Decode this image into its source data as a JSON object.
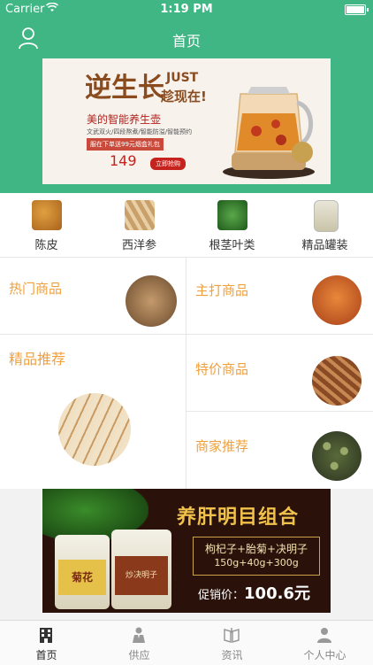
{
  "status_bar": {
    "carrier": "Carrier",
    "time": "1:19 PM"
  },
  "nav": {
    "title": "首页"
  },
  "banner": {
    "headline": "逆生长",
    "headline_en": "JUST",
    "tagline": "趁现在!",
    "subtitle": "美的智能养生壶",
    "features": "文武双火/四段熬煮/智能防溢/智能预约",
    "gift": "服在下单送99元烟盒礼包",
    "price": "149",
    "buy_label": "立即抢购"
  },
  "categories": [
    {
      "label": "陈皮",
      "color": "#c9862e"
    },
    {
      "label": "西洋参",
      "color": "#b98a4e"
    },
    {
      "label": "根茎叶类",
      "color": "#3f8a3a"
    },
    {
      "label": "精品罐装",
      "color": "#d8d8cc"
    }
  ],
  "sections": {
    "hot": "热门商品",
    "main": "主打商品",
    "featured": "精品推荐",
    "special": "特价商品",
    "merchant": "商家推荐"
  },
  "ad": {
    "headline": "养肝明目组合",
    "combo": "枸杞子+胎菊+决明子",
    "weights": "150g+40g+300g",
    "price_label": "促销价：",
    "price_value": "100.6元",
    "jar1": "菊花",
    "jar2": "炒决明子"
  },
  "tabs": [
    {
      "label": "首页",
      "active": true
    },
    {
      "label": "供应",
      "active": false
    },
    {
      "label": "资讯",
      "active": false
    },
    {
      "label": "个人中心",
      "active": false
    }
  ],
  "colors": {
    "brand": "#3fb683",
    "accent": "#f0a03c",
    "tab_active": "#222222",
    "tab_inactive": "#888888"
  }
}
